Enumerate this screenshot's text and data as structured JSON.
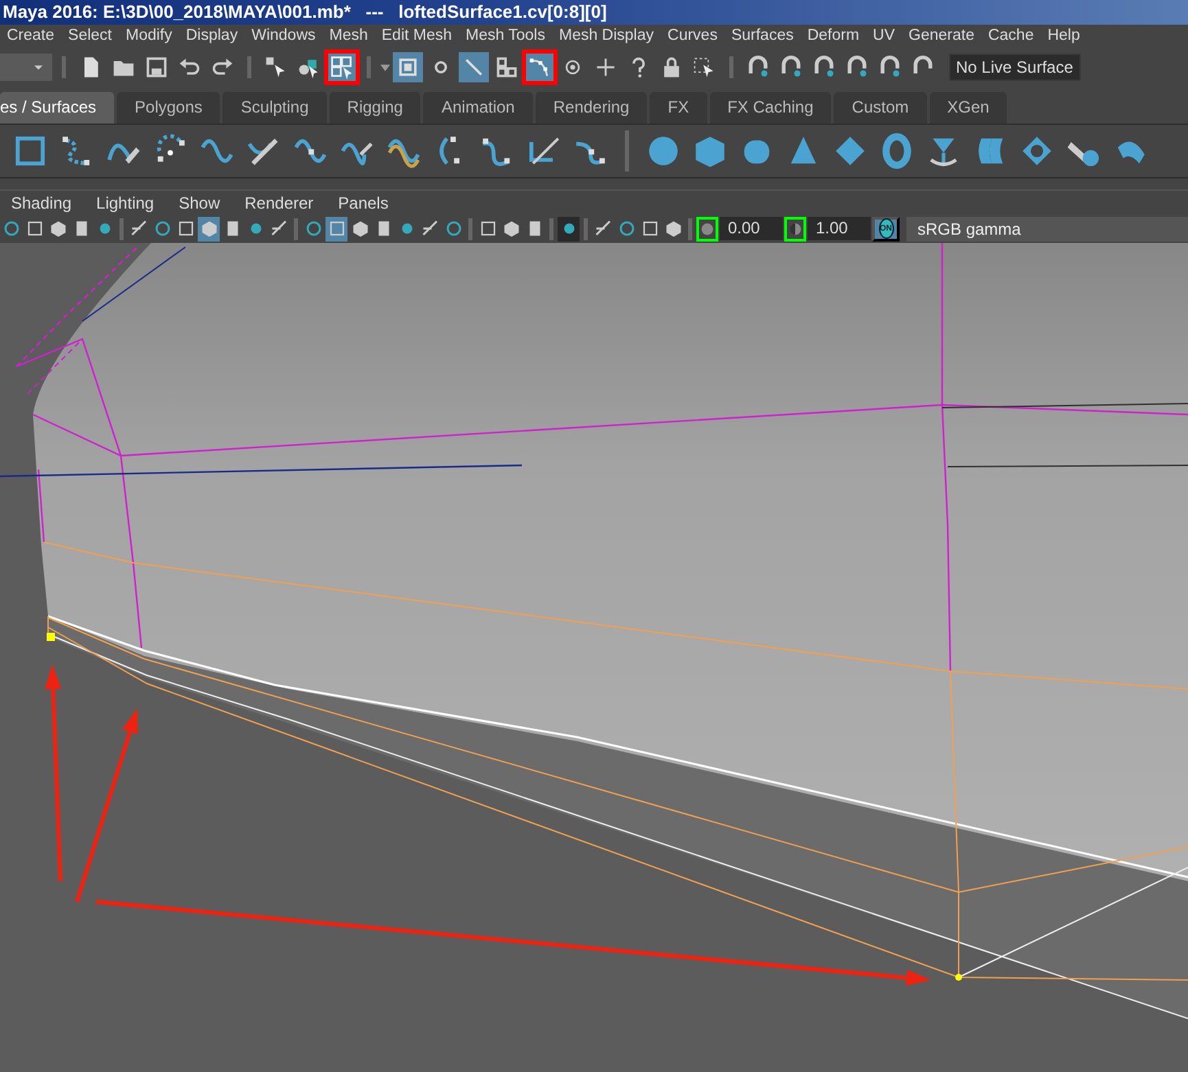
{
  "window": {
    "title": "Maya 2016: E:\\3D\\00_2018\\MAYA\\001.mb*   ---   loftedSurface1.cv[0:8][0]"
  },
  "menu": [
    "Create",
    "Select",
    "Modify",
    "Display",
    "Windows",
    "Mesh",
    "Edit Mesh",
    "Mesh Tools",
    "Mesh Display",
    "Curves",
    "Surfaces",
    "Deform",
    "UV",
    "Generate",
    "Cache",
    "Help"
  ],
  "status_line": {
    "tools": [
      {
        "selected": false,
        "annotated": false
      },
      {
        "selected": false,
        "annotated": false
      },
      {
        "selected": false,
        "annotated": false
      },
      {
        "selected": false,
        "annotated": false
      },
      {
        "selected": false,
        "annotated": false
      },
      {
        "selected": false,
        "annotated": false
      },
      {
        "selected": false,
        "annotated": false
      },
      {
        "selected": true,
        "annotated": true
      },
      {
        "selected": true,
        "annotated": false
      },
      {
        "selected": false,
        "annotated": false
      },
      {
        "selected": true,
        "annotated": false
      },
      {
        "selected": false,
        "annotated": false
      },
      {
        "selected": true,
        "annotated": true
      },
      {
        "selected": false,
        "annotated": false
      },
      {
        "selected": false,
        "annotated": false
      },
      {
        "selected": false,
        "annotated": false
      },
      {
        "selected": false,
        "annotated": false
      },
      {
        "selected": false,
        "annotated": false
      }
    ],
    "live_surface": "No Live Surface"
  },
  "shelf_tabs": [
    {
      "label": "es / Surfaces",
      "selected": true
    },
    {
      "label": "Polygons",
      "selected": false
    },
    {
      "label": "Sculpting",
      "selected": false
    },
    {
      "label": "Rigging",
      "selected": false
    },
    {
      "label": "Animation",
      "selected": false
    },
    {
      "label": "Rendering",
      "selected": false
    },
    {
      "label": "FX",
      "selected": false
    },
    {
      "label": "FX Caching",
      "selected": false
    },
    {
      "label": "Custom",
      "selected": false
    },
    {
      "label": "XGen",
      "selected": false
    }
  ],
  "panel_menu": [
    "Shading",
    "Lighting",
    "Show",
    "Renderer",
    "Panels"
  ],
  "panel_toolbar": {
    "buttons": [
      {
        "selected": false
      },
      {
        "selected": false
      },
      {
        "selected": false
      },
      {
        "selected": false
      },
      {
        "selected": false
      },
      {
        "selected": false
      },
      {
        "selected": false
      },
      {
        "selected": false
      },
      {
        "selected": true
      },
      {
        "selected": false
      },
      {
        "selected": false
      },
      {
        "selected": false
      },
      {
        "selected": false
      },
      {
        "selected": true
      },
      {
        "selected": false
      },
      {
        "selected": false
      },
      {
        "selected": false
      },
      {
        "selected": false
      },
      {
        "selected": false
      },
      {
        "selected": false
      },
      {
        "selected": false
      },
      {
        "selected": false
      },
      {
        "selected": true
      },
      {
        "selected": false
      },
      {
        "selected": false
      },
      {
        "selected": false
      },
      {
        "selected": false
      }
    ],
    "exposure": "0.00",
    "gamma": "1.00",
    "color_management": "ON",
    "view_transform": "sRGB gamma"
  }
}
